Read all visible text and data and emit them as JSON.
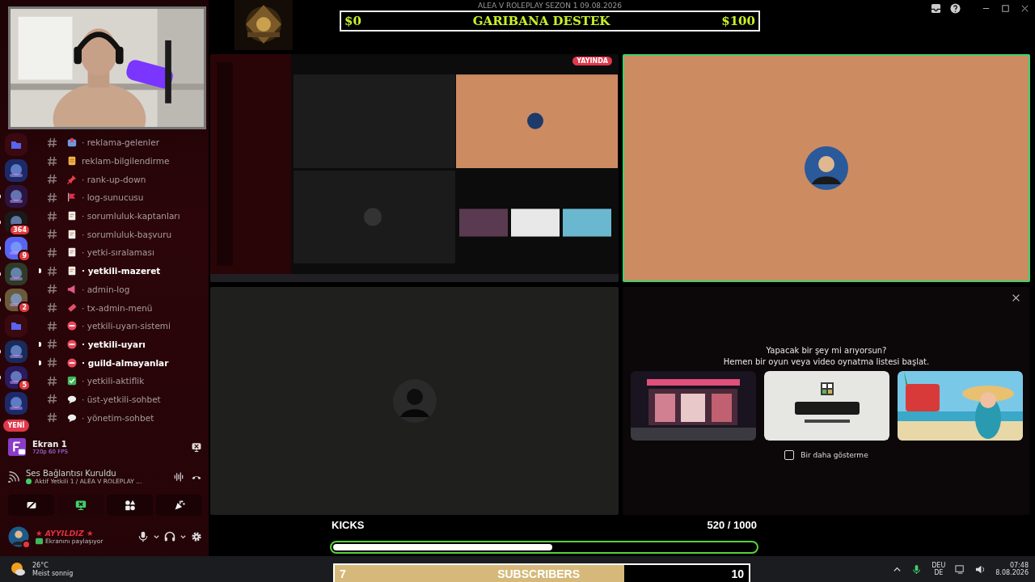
{
  "window": {
    "title": "ALEA V ROLEPLAY SEZON 1 09.08.2026"
  },
  "goal_overlay": {
    "start": "$0",
    "title": "GARIBANA DESTEK",
    "goal": "$100"
  },
  "servers": [
    {
      "kind": "folder",
      "unread": false
    },
    {
      "kind": "server",
      "unread": false
    },
    {
      "kind": "server",
      "unread": true
    },
    {
      "kind": "server",
      "unread": true,
      "badge": "364"
    },
    {
      "kind": "server",
      "unread": true,
      "badge": "9"
    },
    {
      "kind": "server",
      "unread": true
    },
    {
      "kind": "server",
      "unread": true,
      "badge": "2"
    },
    {
      "kind": "folder",
      "unread": false
    },
    {
      "kind": "server",
      "unread": true
    },
    {
      "kind": "server",
      "unread": true,
      "badge": "5"
    },
    {
      "kind": "server",
      "unread": false
    }
  ],
  "new_badge": "YENİ",
  "channels": [
    {
      "kind": "inbox",
      "name": "· reklama-gelenler",
      "unread": false
    },
    {
      "kind": "scroll",
      "name": "reklam-bilgilendirme",
      "unread": false
    },
    {
      "kind": "pin",
      "name": "· rank-up-down",
      "unread": false
    },
    {
      "kind": "flag",
      "name": "· log-sunucusu",
      "unread": false
    },
    {
      "kind": "document",
      "name": "· sorumluluk-kaptanları",
      "unread": false
    },
    {
      "kind": "document",
      "name": "· sorumluluk-başvuru",
      "unread": false
    },
    {
      "kind": "document",
      "name": "· yetki-sıralaması",
      "unread": false
    },
    {
      "kind": "document",
      "name": "· yetkili-mazeret",
      "unread": true
    },
    {
      "kind": "megaphone",
      "name": "· admin-log",
      "unread": false
    },
    {
      "kind": "ticket",
      "name": "· tx-admin-menü",
      "unread": false
    },
    {
      "kind": "blocked",
      "name": "· yetkili-uyarı-sistemi",
      "unread": false
    },
    {
      "kind": "blocked",
      "name": "· yetkili-uyarı",
      "unread": true
    },
    {
      "kind": "blocked",
      "name": "· guild-almayanlar",
      "unread": true
    },
    {
      "kind": "check",
      "name": "· yetkili-aktiflik",
      "unread": false
    },
    {
      "kind": "speech",
      "name": "· üst-yetkili-sohbet",
      "unread": false
    },
    {
      "kind": "speech",
      "name": "· yönetim-sohbet",
      "unread": false
    }
  ],
  "stream_panel": {
    "title": "Ekran 1",
    "quality": "720p 60 FPS"
  },
  "voice": {
    "status": "Ses Bağlantısı Kuruldu",
    "channel": "Aktif Yetkili 1 / ALEA V ROLEPLAY ..."
  },
  "voice_buttons": [
    {
      "kind": "camera-off",
      "on": false
    },
    {
      "kind": "screen-share",
      "on": true
    },
    {
      "kind": "activities",
      "on": false
    },
    {
      "kind": "soundboard",
      "on": false
    }
  ],
  "user": {
    "name": "★ AYYILDIZ ★",
    "status": "Ekranını paylaşıyor"
  },
  "tiles": [
    {
      "kind": "stream",
      "badge": "YAYINDA",
      "speaking": false
    },
    {
      "kind": "user",
      "color": "#cd8b62",
      "speaking": true
    },
    {
      "kind": "user",
      "color": "#1f1f1e",
      "speaking": false
    },
    {
      "kind": "activity"
    }
  ],
  "activity_prompt": {
    "line_1": "Yapacak bir şey mi arıyorsun?",
    "line_2": "Hemen bir oyun veya video oynatma listesi başlat.",
    "dont_show_again": {
      "label": "Bir daha gösterme",
      "checked": false
    }
  },
  "kicks": {
    "label": "KICKS",
    "count": "520 / 1000",
    "level": 0.52
  },
  "subscribers": {
    "current": "7",
    "label": "SUBSCRIBERS",
    "goal": "10",
    "level": 0.7
  },
  "taskbar": {
    "temperature": "26°C",
    "weather": "Meist sonnig",
    "language": "DEU",
    "layout": "DE",
    "time": "07:48",
    "date": "8.08.2026"
  }
}
